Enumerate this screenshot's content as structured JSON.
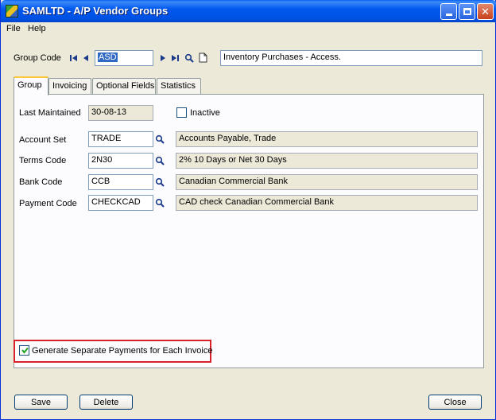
{
  "window": {
    "title": "SAMLTD - A/P Vendor Groups"
  },
  "menu": {
    "items": [
      "File",
      "Help"
    ]
  },
  "header": {
    "group_code_label": "Group Code",
    "group_code_value": "ASD",
    "description_value": "Inventory Purchases - Access."
  },
  "tabs": [
    {
      "label": "Group",
      "active": true
    },
    {
      "label": "Invoicing",
      "active": false
    },
    {
      "label": "Optional Fields",
      "active": false
    },
    {
      "label": "Statistics",
      "active": false
    }
  ],
  "group_tab": {
    "last_maintained_label": "Last Maintained",
    "last_maintained_value": "30-08-13",
    "inactive_label": "Inactive",
    "inactive_checked": false,
    "rows": [
      {
        "label": "Account Set",
        "code": "TRADE",
        "description": "Accounts Payable, Trade"
      },
      {
        "label": "Terms Code",
        "code": "2N30",
        "description": "2% 10 Days or Net 30 Days"
      },
      {
        "label": "Bank Code",
        "code": "CCB",
        "description": "Canadian Commercial Bank"
      },
      {
        "label": "Payment Code",
        "code": "CHECKCAD",
        "description": "CAD check Canadian Commercial Bank"
      }
    ],
    "generate_payments_label": "Generate Separate Payments for Each Invoice",
    "generate_payments_checked": true
  },
  "buttons": {
    "save": "Save",
    "delete": "Delete",
    "close": "Close"
  },
  "colors": {
    "highlight_border": "#d8202a",
    "titlebar": "#0058ee"
  }
}
